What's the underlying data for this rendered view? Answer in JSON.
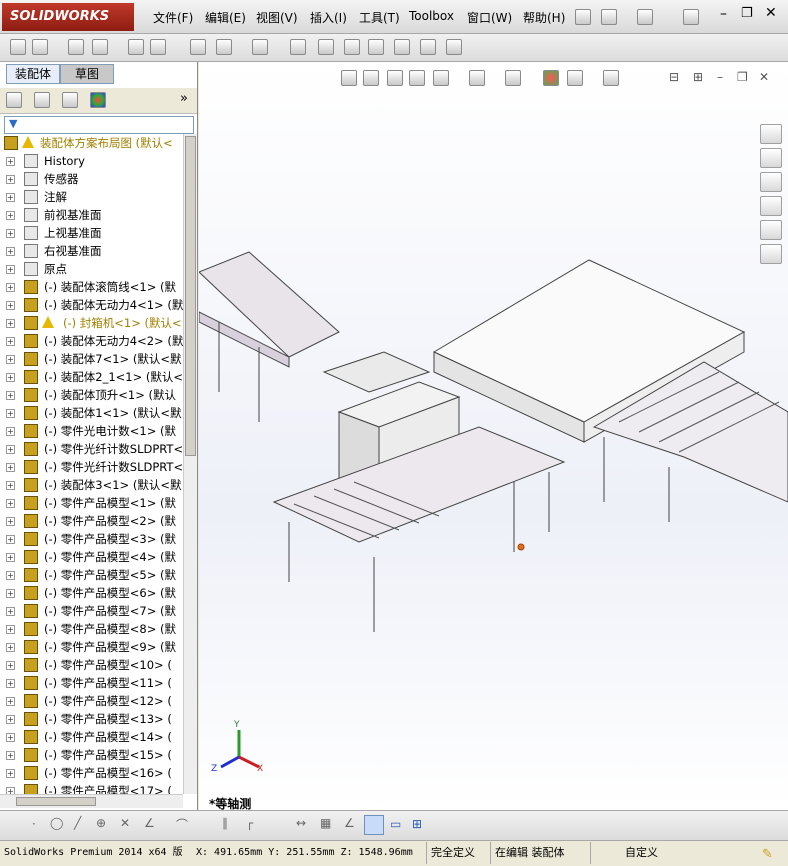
{
  "app": {
    "logo_text": "SOLIDWORKS"
  },
  "menu": [
    "文件(F)",
    "编辑(E)",
    "视图(V)",
    "插入(I)",
    "工具(T)",
    "Toolbox",
    "窗口(W)",
    "帮助(H)"
  ],
  "panel_tabs": [
    "装配体",
    "草图"
  ],
  "tree": {
    "root": "装配体方案布局图 (默认<",
    "items": [
      {
        "label": "History",
        "prefix": "",
        "warn": false,
        "icon": "history-icon"
      },
      {
        "label": "传感器",
        "prefix": "",
        "warn": false,
        "icon": "sensor-icon"
      },
      {
        "label": "注解",
        "prefix": "",
        "warn": false,
        "icon": "annotation-icon"
      },
      {
        "label": "前视基准面",
        "prefix": "",
        "warn": false,
        "icon": "plane-icon"
      },
      {
        "label": "上视基准面",
        "prefix": "",
        "warn": false,
        "icon": "plane-icon"
      },
      {
        "label": "右视基准面",
        "prefix": "",
        "warn": false,
        "icon": "plane-icon"
      },
      {
        "label": "原点",
        "prefix": "",
        "warn": false,
        "icon": "origin-icon"
      },
      {
        "label": "(-) 装配体滚筒线<1> (默",
        "warn": false,
        "icon": "assembly-icon"
      },
      {
        "label": "(-) 装配体无动力4<1> (默",
        "warn": false,
        "icon": "assembly-icon"
      },
      {
        "label": "(-) 封箱机<1> (默认<",
        "warn": true,
        "icon": "assembly-icon"
      },
      {
        "label": "(-) 装配体无动力4<2> (默",
        "warn": false,
        "icon": "assembly-icon"
      },
      {
        "label": "(-) 装配体7<1> (默认<默",
        "warn": false,
        "icon": "assembly-icon"
      },
      {
        "label": "(-) 装配体2_1<1> (默认<",
        "warn": false,
        "icon": "assembly-icon"
      },
      {
        "label": "(-) 装配体顶升<1> (默认",
        "warn": false,
        "icon": "assembly-icon"
      },
      {
        "label": "(-) 装配体1<1> (默认<默",
        "warn": false,
        "icon": "assembly-icon"
      },
      {
        "label": "(-) 零件光电计数<1> (默",
        "warn": false,
        "icon": "part-icon"
      },
      {
        "label": "(-) 零件光纤计数SLDPRT<",
        "warn": false,
        "icon": "part-icon"
      },
      {
        "label": "(-) 零件光纤计数SLDPRT<",
        "warn": false,
        "icon": "part-icon"
      },
      {
        "label": "(-) 装配体3<1> (默认<默",
        "warn": false,
        "icon": "assembly-icon"
      },
      {
        "label": "(-) 零件产品模型<1> (默",
        "warn": false,
        "icon": "part-icon"
      },
      {
        "label": "(-) 零件产品模型<2> (默",
        "warn": false,
        "icon": "part-icon"
      },
      {
        "label": "(-) 零件产品模型<3> (默",
        "warn": false,
        "icon": "part-icon"
      },
      {
        "label": "(-) 零件产品模型<4> (默",
        "warn": false,
        "icon": "part-icon"
      },
      {
        "label": "(-) 零件产品模型<5> (默",
        "warn": false,
        "icon": "part-icon"
      },
      {
        "label": "(-) 零件产品模型<6> (默",
        "warn": false,
        "icon": "part-icon"
      },
      {
        "label": "(-) 零件产品模型<7> (默",
        "warn": false,
        "icon": "part-icon"
      },
      {
        "label": "(-) 零件产品模型<8> (默",
        "warn": false,
        "icon": "part-icon"
      },
      {
        "label": "(-) 零件产品模型<9> (默",
        "warn": false,
        "icon": "part-icon"
      },
      {
        "label": "(-) 零件产品模型<10> (",
        "warn": false,
        "icon": "part-icon"
      },
      {
        "label": "(-) 零件产品模型<11> (",
        "warn": false,
        "icon": "part-icon"
      },
      {
        "label": "(-) 零件产品模型<12> (",
        "warn": false,
        "icon": "part-icon"
      },
      {
        "label": "(-) 零件产品模型<13> (",
        "warn": false,
        "icon": "part-icon"
      },
      {
        "label": "(-) 零件产品模型<14> (",
        "warn": false,
        "icon": "part-icon"
      },
      {
        "label": "(-) 零件产品模型<15> (",
        "warn": false,
        "icon": "part-icon"
      },
      {
        "label": "(-) 零件产品模型<16> (",
        "warn": false,
        "icon": "part-icon"
      },
      {
        "label": "(-) 零件产品模型<17> (",
        "warn": false,
        "icon": "part-icon"
      }
    ]
  },
  "viewport": {
    "view_label": "*等轴测",
    "triad": {
      "x": "X",
      "y": "Y",
      "z": "Z"
    }
  },
  "status": {
    "product": "SolidWorks Premium 2014 x64 版",
    "coords": "X: 491.65mm Y: 251.55mm Z: 1548.96mm",
    "state": "完全定义",
    "mode": "在编辑 装配体",
    "custom": "自定义"
  },
  "colors": {
    "accent": "#c0392b",
    "panel_bg": "#ffffff",
    "warn": "#e6b800"
  }
}
